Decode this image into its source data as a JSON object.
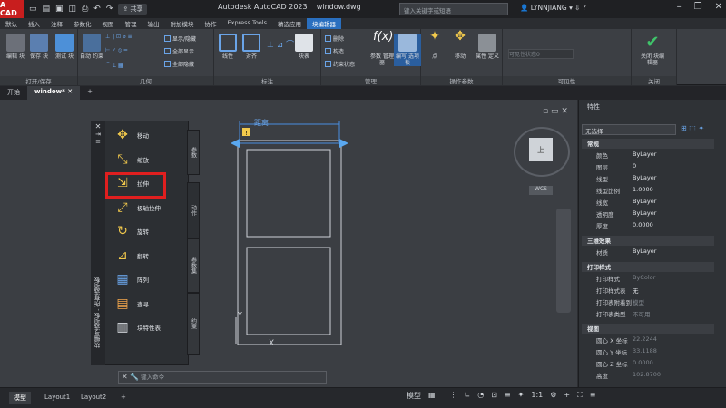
{
  "app": {
    "logo": "A CAD",
    "title": "Autodesk AutoCAD 2023",
    "file": "window.dwg",
    "search_placeholder": "键入关键字或短语",
    "user": "LYNNJIANG",
    "share": "共享"
  },
  "ribbon_tabs": [
    "默认",
    "插入",
    "注释",
    "参数化",
    "视图",
    "管理",
    "输出",
    "附加模块",
    "协作",
    "Express Tools",
    "精选应用",
    "块编辑器"
  ],
  "ribbon_active": 11,
  "ribbon": {
    "open_save": {
      "label": "打开/保存",
      "edit_block": "编辑\n块",
      "save_block": "保存\n块",
      "test_block": "测试\n块"
    },
    "geometry": {
      "label": "几何",
      "auto_constrain": "自动\n约束",
      "show_hide": "显示/隐藏",
      "show_all": "全部显示",
      "hide_all": "全部隐藏"
    },
    "dimensional": {
      "label": "标注",
      "linear": "线性",
      "aligned": "对齐",
      "block_table": "块表"
    },
    "manage": {
      "label": "管理",
      "delete": "删除",
      "convert": "构造",
      "constraint_state": "约束状态",
      "params_manager": "参数\n管理器",
      "authoring_palettes": "编写\n选项板"
    },
    "action_params": {
      "label": "操作参数",
      "point": "点",
      "move": "移动",
      "attr_def": "属性\n定义"
    },
    "visibility": {
      "label": "可见性",
      "vis_state": "可见性状态0"
    },
    "close": {
      "label": "关闭",
      "close_editor": "关闭\n块编辑器"
    }
  },
  "doc_tabs": [
    "开始",
    "window*"
  ],
  "palette": {
    "title": "块编写选项板 - 所有选项板",
    "tabs": [
      "参数",
      "动作",
      "参数集",
      "约束"
    ],
    "items": [
      "移动",
      "缩放",
      "拉伸",
      "极轴拉伸",
      "旋转",
      "翻转",
      "阵列",
      "查寻",
      "块特性表"
    ]
  },
  "canvas": {
    "dim_label": "距离",
    "ucs_y": "Y",
    "ucs_x": "X",
    "viewcube_label": "上",
    "wcs": "WCS",
    "cmd_placeholder": "键入命令"
  },
  "properties": {
    "title": "特性",
    "selection": "无选择",
    "sections": [
      {
        "name": "常规",
        "rows": [
          [
            "颜色",
            "ByLayer"
          ],
          [
            "图层",
            "0"
          ],
          [
            "线型",
            "ByLayer"
          ],
          [
            "线型比例",
            "1.0000"
          ],
          [
            "线宽",
            "ByLayer"
          ],
          [
            "透明度",
            "ByLayer"
          ],
          [
            "厚度",
            "0.0000"
          ]
        ]
      },
      {
        "name": "三维效果",
        "rows": [
          [
            "材质",
            "ByLayer"
          ]
        ]
      },
      {
        "name": "打印样式",
        "rows": [
          [
            "打印样式",
            "ByColor"
          ],
          [
            "打印样式表",
            "无"
          ],
          [
            "打印表附着到",
            "模型"
          ],
          [
            "打印表类型",
            "不可用"
          ]
        ]
      },
      {
        "name": "视图",
        "rows": [
          [
            "圆心 X 坐标",
            "22.2244"
          ],
          [
            "圆心 Y 坐标",
            "33.1188"
          ],
          [
            "圆心 Z 坐标",
            "0.0000"
          ],
          [
            "高度",
            "102.8700"
          ]
        ]
      }
    ]
  },
  "status": {
    "tabs": [
      "模型",
      "Layout1",
      "Layout2"
    ],
    "model": "模型",
    "scale": "1:1"
  }
}
